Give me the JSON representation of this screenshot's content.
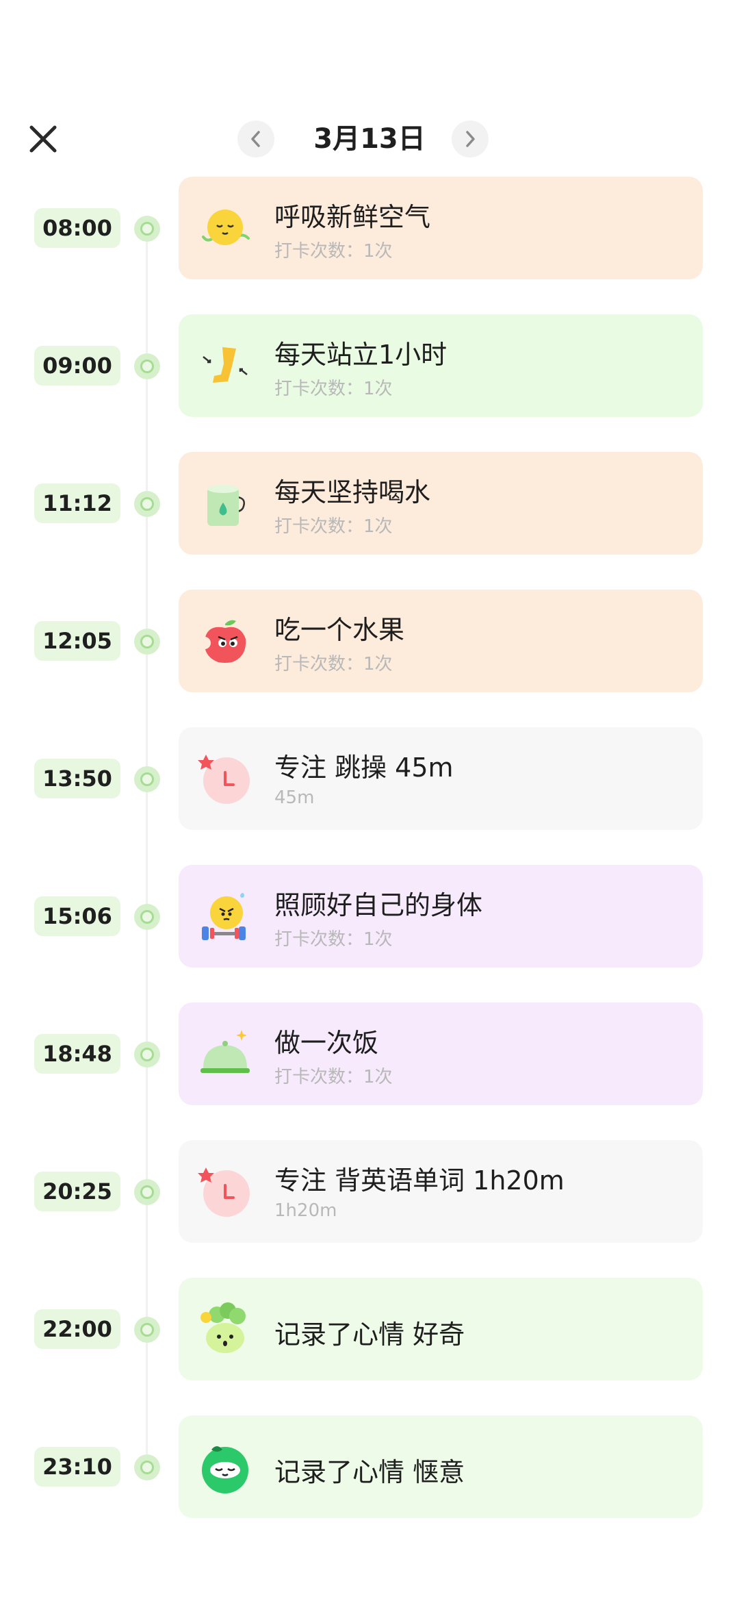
{
  "header": {
    "date": "3月13日",
    "close_icon": "close-icon",
    "prev_icon": "chevron-left-icon",
    "next_icon": "chevron-right-icon"
  },
  "entries": [
    {
      "time": "08:00",
      "title": "呼吸新鲜空气",
      "subtitle": "打卡次数：1次",
      "icon": "sun-face-icon",
      "color": "#fdebdc"
    },
    {
      "time": "09:00",
      "title": "每天站立1小时",
      "subtitle": "打卡次数：1次",
      "icon": "standing-leg-icon",
      "color": "#e9fbe2"
    },
    {
      "time": "11:12",
      "title": "每天坚持喝水",
      "subtitle": "打卡次数：1次",
      "icon": "water-cup-icon",
      "color": "#fdebdc"
    },
    {
      "time": "12:05",
      "title": "吃一个水果",
      "subtitle": "打卡次数：1次",
      "icon": "apple-icon",
      "color": "#fdebdc"
    },
    {
      "time": "13:50",
      "title": "专注 跳操 45m",
      "subtitle": "45m",
      "icon": "focus-clock-icon",
      "color": "#f7f7f7"
    },
    {
      "time": "15:06",
      "title": "照顾好自己的身体",
      "subtitle": "打卡次数：1次",
      "icon": "dumbbell-face-icon",
      "color": "#f6eafc"
    },
    {
      "time": "18:48",
      "title": "做一次饭",
      "subtitle": "打卡次数：1次",
      "icon": "food-cloche-icon",
      "color": "#f6eafc"
    },
    {
      "time": "20:25",
      "title": "专注 背英语单词 1h20m",
      "subtitle": "1h20m",
      "icon": "focus-clock-icon",
      "color": "#f7f7f7"
    },
    {
      "time": "22:00",
      "title": "记录了心情 好奇",
      "subtitle": "",
      "icon": "curious-mood-icon",
      "color": "#effbe9"
    },
    {
      "time": "23:10",
      "title": "记录了心情 惬意",
      "subtitle": "",
      "icon": "relaxed-mood-icon",
      "color": "#effbe9"
    }
  ]
}
